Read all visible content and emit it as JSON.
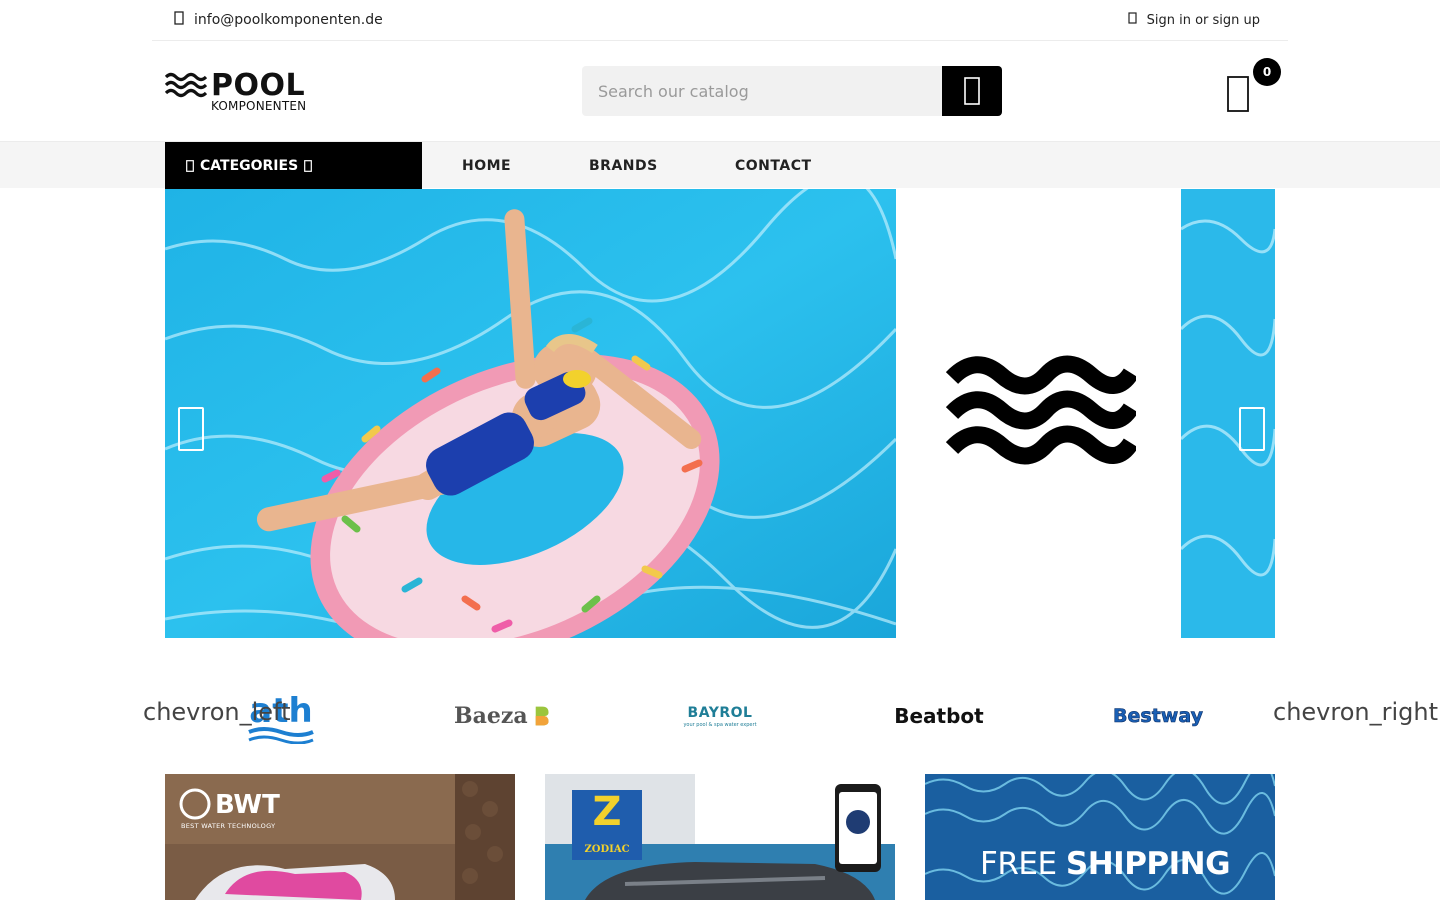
{
  "topbar": {
    "email": "info@poolkomponenten.de",
    "signin": "Sign in or sign up"
  },
  "logo": {
    "word": "POOL",
    "sub": "KOMPONENTEN"
  },
  "search": {
    "placeholder": "Search our catalog"
  },
  "cart": {
    "count": "0"
  },
  "nav": {
    "categories": "CATEGORIES",
    "links": [
      "HOME",
      "BRANDS",
      "CONTACT"
    ]
  },
  "brands": {
    "prev": "chevron_left",
    "next": "chevron_right",
    "items": [
      "ath",
      "Baeza",
      "BAYROL",
      "Beatbot",
      "Bestway"
    ],
    "bayrol_tagline": "your pool & spa water expert"
  },
  "tiles": {
    "bwt_title": "BWT",
    "bwt_sub": "BEST WATER TECHNOLOGY",
    "zodiac": "ZODIAC",
    "shipping_a": "FREE",
    "shipping_b": "SHIPPING"
  },
  "colors": {
    "accent": "#000000",
    "nav_bg": "#f5f5f5",
    "pool_blue": "#29b6e4",
    "ath_blue": "#1d7fd1"
  }
}
